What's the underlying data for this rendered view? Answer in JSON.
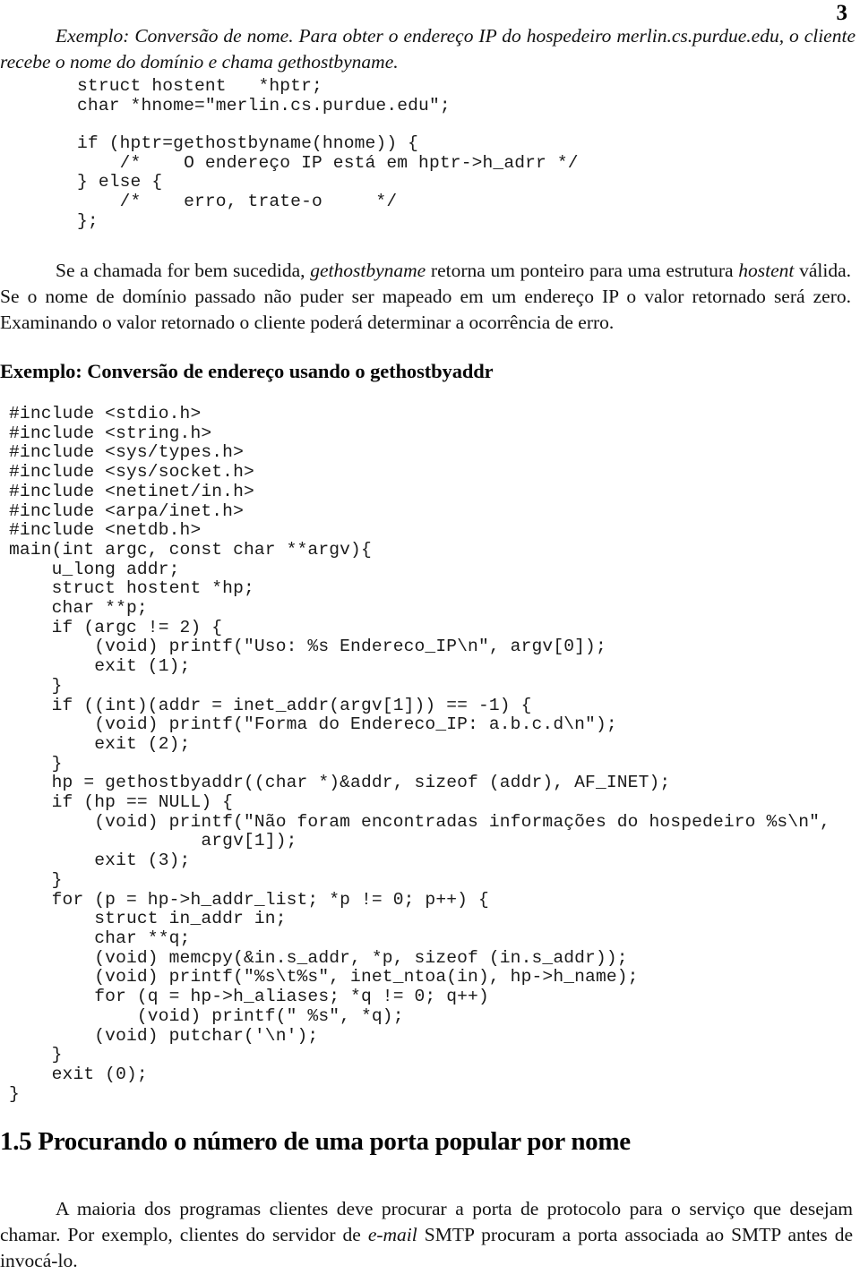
{
  "page": {
    "number": "3"
  },
  "intro_paragraph": "Exemplo: Conversão de nome. Para obter o endereço IP do hospedeiro merlin.cs.purdue.edu, o cliente recebe o nome do domínio e chama gethostbyname.",
  "code_snippet_1": "struct hostent   *hptr;\nchar *hnome=\"merlin.cs.purdue.edu\";",
  "code_snippet_2": "if (hptr=gethostbyname(hnome)) {\n    /*    O endereço IP está em hptr->h_adrr */\n} else {\n    /*    erro, trate-o     */\n};",
  "result_paragraph": "Se a chamada for bem sucedida, gethostbyname retorna um ponteiro para uma estrutura hostent válida. Se o nome de domínio passado não puder ser mapeado em um endereço IP o valor retornado será zero. Examinando o valor retornado o cliente poderá determinar a ocorrência de erro.",
  "example_heading": "Exemplo: Conversão de endereço usando o gethostbyaddr",
  "main_code": "#include <stdio.h>\n#include <string.h>\n#include <sys/types.h>\n#include <sys/socket.h>\n#include <netinet/in.h>\n#include <arpa/inet.h>\n#include <netdb.h>\nmain(int argc, const char **argv){\n    u_long addr;\n    struct hostent *hp;\n    char **p;\n    if (argc != 2) {\n        (void) printf(\"Uso: %s Endereco_IP\\n\", argv[0]);\n        exit (1);\n    }\n    if ((int)(addr = inet_addr(argv[1])) == -1) {\n        (void) printf(\"Forma do Endereco_IP: a.b.c.d\\n\");\n        exit (2);\n    }\n    hp = gethostbyaddr((char *)&addr, sizeof (addr), AF_INET);\n    if (hp == NULL) {\n        (void) printf(\"Não foram encontradas informações do hospedeiro %s\\n\",\n                  argv[1]);\n        exit (3);\n    }\n    for (p = hp->h_addr_list; *p != 0; p++) {\n        struct in_addr in;\n        char **q;\n        (void) memcpy(&in.s_addr, *p, sizeof (in.s_addr));\n        (void) printf(\"%s\\t%s\", inet_ntoa(in), hp->h_name);\n        for (q = hp->h_aliases; *q != 0; q++)\n            (void) printf(\" %s\", *q);\n        (void) putchar('\\n');\n    }\n    exit (0);\n}",
  "section_heading": "1.5 Procurando o número de uma porta popular por nome",
  "closing_paragraph": "A maioria dos programas clientes deve procurar a porta de protocolo para o serviço que desejam chamar. Por exemplo, clientes do servidor de e-mail SMTP procuram a porta associada ao SMTP antes de invocá-lo."
}
